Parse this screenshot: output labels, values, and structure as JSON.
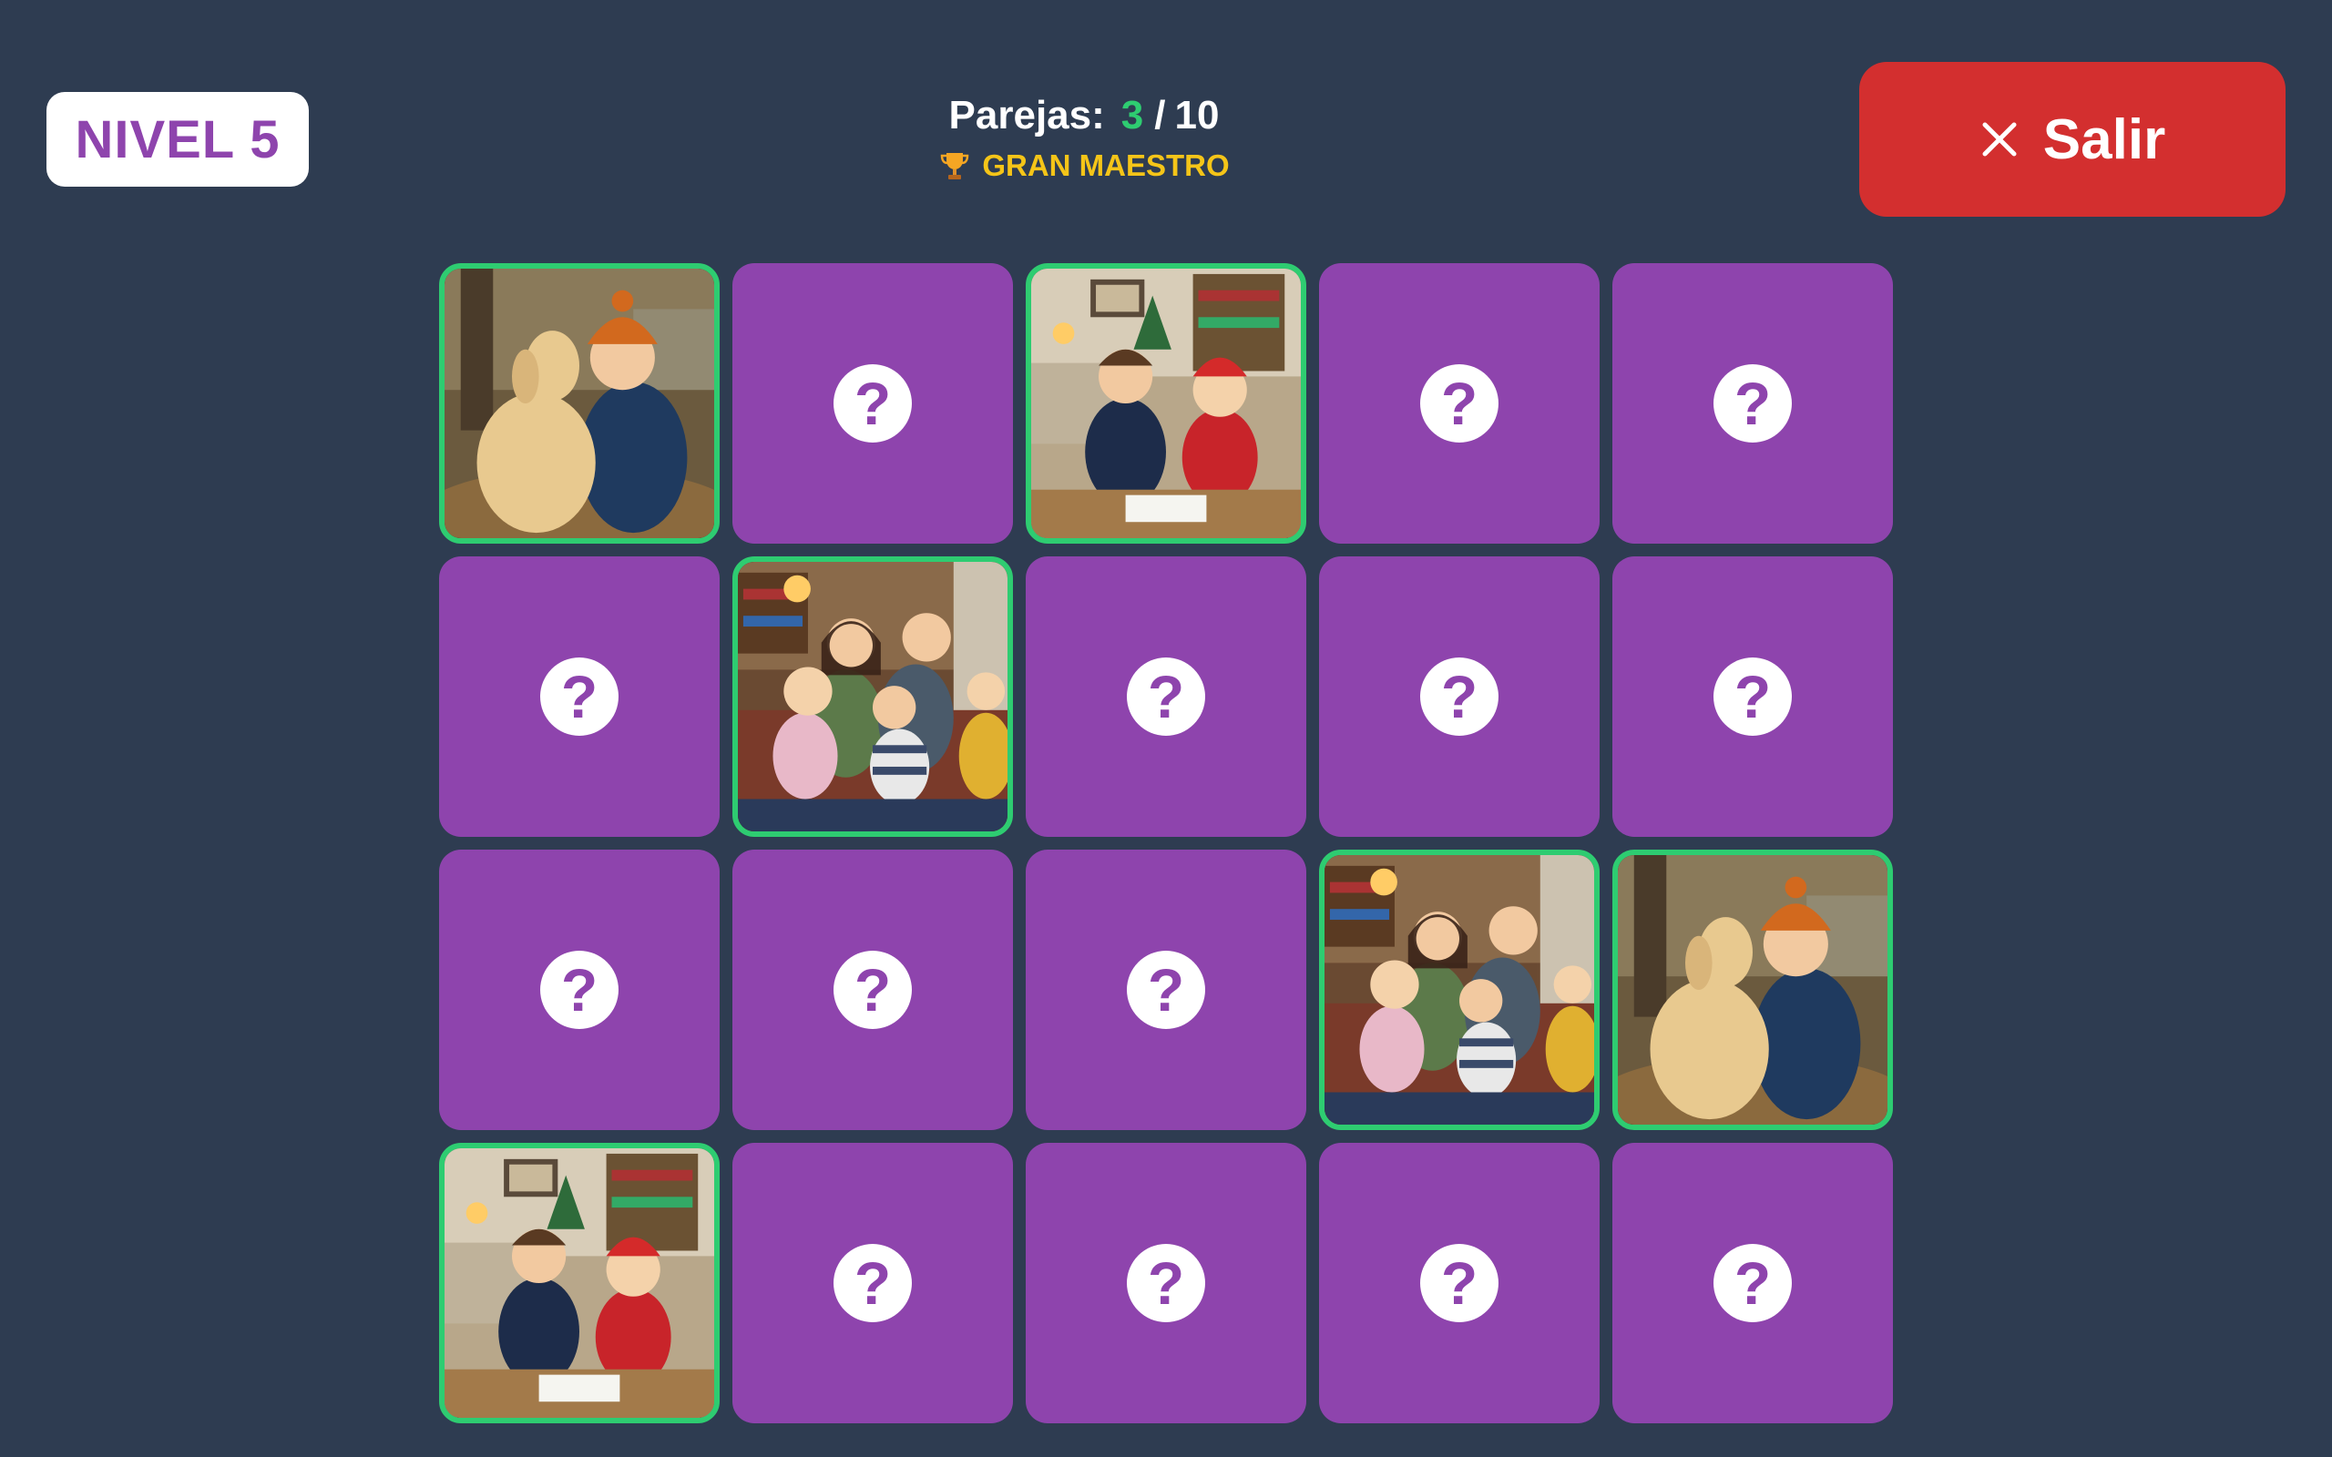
{
  "header": {
    "level_label": "NIVEL 5",
    "score_label": "Parejas:",
    "matched_count": "3",
    "score_separator": "/",
    "total_pairs": "10",
    "rank_title": "GRAN MAESTRO",
    "exit_label": "Salir"
  },
  "icons": {
    "trophy": "trophy-icon",
    "close": "close-icon",
    "card_back": "question-mark-icon"
  },
  "colors": {
    "background": "#2e3c51",
    "card_back": "#8e44ad",
    "matched_border": "#2ecc71",
    "exit_button": "#d32f2f",
    "rank_text": "#f5c518"
  },
  "card_back_symbol": "?",
  "cards": [
    {
      "state": "matched",
      "image": "boy-hugging-dog"
    },
    {
      "state": "hidden"
    },
    {
      "state": "matched",
      "image": "kids-drawing-christmas"
    },
    {
      "state": "hidden"
    },
    {
      "state": "hidden"
    },
    {
      "state": "hidden"
    },
    {
      "state": "matched",
      "image": "family-on-sofa"
    },
    {
      "state": "hidden"
    },
    {
      "state": "hidden"
    },
    {
      "state": "hidden"
    },
    {
      "state": "hidden"
    },
    {
      "state": "hidden"
    },
    {
      "state": "hidden"
    },
    {
      "state": "matched",
      "image": "family-on-sofa"
    },
    {
      "state": "matched",
      "image": "boy-hugging-dog"
    },
    {
      "state": "matched",
      "image": "kids-drawing-christmas"
    },
    {
      "state": "hidden"
    },
    {
      "state": "hidden"
    },
    {
      "state": "hidden"
    },
    {
      "state": "hidden"
    }
  ]
}
